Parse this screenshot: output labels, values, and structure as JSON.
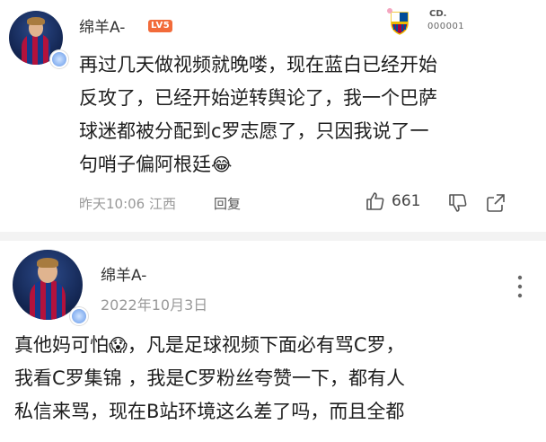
{
  "comment1": {
    "username": "绵羊A-",
    "level": "LV5",
    "fan_badge_text": "CD.",
    "fan_badge_number": "000001",
    "text_lines": [
      "再过几天做视频就晚喽，现在蓝白已经开始",
      "反攻了，已经开始逆转舆论了，我一个巴萨",
      "球迷都被分配到c罗志愿了，只因我说了一",
      "句哨子偏阿根廷"
    ],
    "emoji": "😂",
    "time": "昨天10:06",
    "location": "江西",
    "reply_label": "回复",
    "like_count": "661"
  },
  "comment2": {
    "username": "绵羊A-",
    "date": "2022年10月3日",
    "text_lines": [
      "真他妈可怕",
      "我看C罗集锦 ，我是C罗粉丝夸赞一下，都有人",
      "私信来骂，现在B站环境这么差了吗，而且全都"
    ],
    "line1_rest": "，凡是足球视频下面必有骂C罗，",
    "emoji": "😱"
  },
  "colors": {
    "level_badge": "#f26b3a",
    "divider": "#f3f3f3"
  },
  "icons": [
    "thumb-up-icon",
    "thumb-down-icon",
    "share-icon",
    "more-icon",
    "verified-icon",
    "fan-badge-icon"
  ]
}
